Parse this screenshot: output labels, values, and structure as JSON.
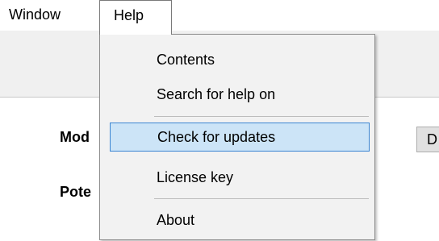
{
  "menubar": {
    "window_label": "Window",
    "help_label": "Help"
  },
  "help_menu": {
    "items": [
      {
        "label": "Contents"
      },
      {
        "label": "Search for help on"
      },
      {
        "label": "Check for updates",
        "highlighted": true
      },
      {
        "label": "License key"
      },
      {
        "label": "About"
      }
    ]
  },
  "background": {
    "label_mod": "Mod",
    "label_pote": "Pote",
    "button_label": "D"
  },
  "colors": {
    "highlight_fill": "#cce4f7",
    "highlight_border": "#3a84d2",
    "menu_background": "#f2f2f2"
  }
}
